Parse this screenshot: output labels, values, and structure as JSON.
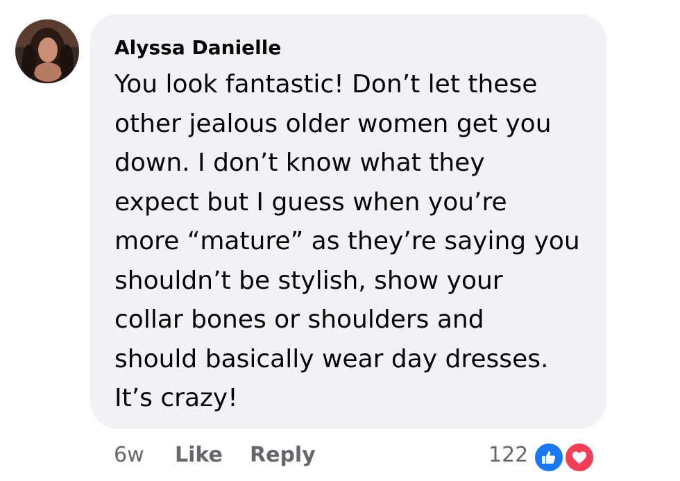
{
  "comment": {
    "author": "Alyssa Danielle",
    "text": "You look fantastic! Don’t let these\nother jealous older women get you\ndown. I don’t know what they\nexpect but I guess when you’re\nmore “mature” as they’re saying you\nshouldn’t be stylish, show your\ncollar bones or shoulders and\nshould basically wear day dresses.\nIt’s crazy!",
    "avatar_icon": "profile-photo"
  },
  "actions": {
    "time": "6w",
    "like_label": "Like",
    "reply_label": "Reply"
  },
  "reactions": {
    "count": "122",
    "types": [
      "like-icon",
      "love-icon"
    ],
    "colors": {
      "like": "#1877f2",
      "love": "#f33e58"
    }
  },
  "colors": {
    "bubble": "#f0f2f5",
    "text": "#050505",
    "secondary": "#65676b"
  }
}
